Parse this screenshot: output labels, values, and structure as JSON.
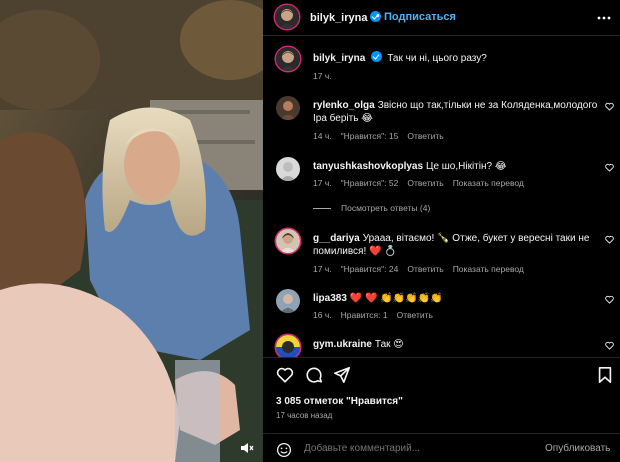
{
  "post": {
    "username": "bilyk_iryna",
    "separator": "•",
    "follow_label": "Подписаться",
    "caption": "Так чи ні, цього разу?",
    "caption_time": "17 ч."
  },
  "comments": [
    {
      "username": "rylenko_olga",
      "text": "Звісно що так,тільки не за Коляденка,молодого Іра беріть 😂",
      "time": "14 ч.",
      "likes": "\"Нравится\": 15",
      "reply": "Ответить",
      "translate": ""
    },
    {
      "username": "tanyushkashovkoplyas",
      "text": "Це шо,Нікітін? 😂",
      "time": "17 ч.",
      "likes": "\"Нравится\": 52",
      "reply": "Ответить",
      "translate": "Показать перевод"
    },
    {
      "username": "g__dariya",
      "text": "Урааа, вітаємо! 🍾 Отже, букет у вересні таки не помилився! ❤️ 💍",
      "time": "17 ч.",
      "likes": "\"Нравится\": 24",
      "reply": "Ответить",
      "translate": "Показать перевод"
    },
    {
      "username": "lipa383",
      "text": "❤️ ❤️ 👏👏👏👏👏",
      "time": "16 ч.",
      "likes": "Нравится: 1",
      "reply": "Ответить",
      "translate": ""
    },
    {
      "username": "gym.ukraine",
      "text": "Так 😍",
      "time": "",
      "likes": "",
      "reply": "",
      "translate": ""
    }
  ],
  "view_replies": "Посмотреть ответы (4)",
  "likes_count": "3 085 отметок \"Нравится\"",
  "posted_ago": "17 часов назад",
  "add_comment_placeholder": "Добавьте комментарий...",
  "publish_label": "Опубликовать",
  "colors": {
    "accent": "#0095f6",
    "link": "#4bb4f8",
    "muted": "#a8a8a8",
    "bg": "#000000"
  },
  "icons": [
    "more-icon",
    "heart-icon",
    "comment-icon",
    "share-icon",
    "bookmark-icon",
    "emoji-icon",
    "mute-icon",
    "verified-icon"
  ]
}
